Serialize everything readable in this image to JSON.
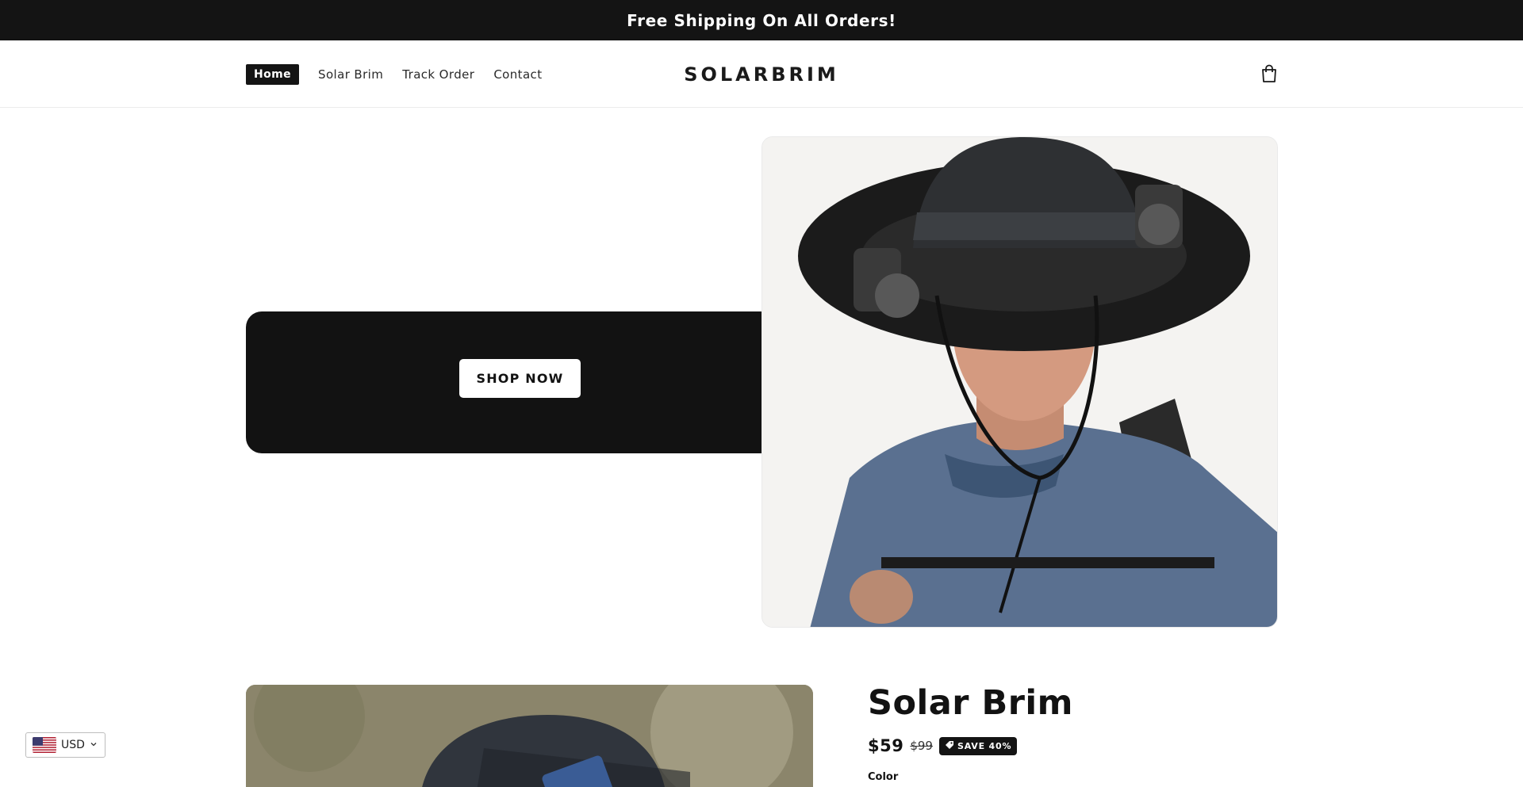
{
  "announcement": {
    "text": "Free Shipping On All Orders!"
  },
  "header": {
    "logo_text": "SOLARBRIM",
    "nav": [
      {
        "label": "Home",
        "active": true
      },
      {
        "label": "Solar Brim",
        "active": false
      },
      {
        "label": "Track Order",
        "active": false
      },
      {
        "label": "Contact",
        "active": false
      }
    ],
    "cart_icon": "shopping-bag-icon"
  },
  "hero": {
    "button_label": "SHOP NOW",
    "image_icon": "man-wearing-solar-fan-hat-photo"
  },
  "product": {
    "title": "Solar Brim",
    "price": "$59",
    "compare_price": "$99",
    "save_badge": "SAVE 40%",
    "badge_icon": "tag-icon",
    "option_label": "Color",
    "image_icon": "solar-hat-product-photo"
  },
  "currency": {
    "code": "USD",
    "flag_icon": "us-flag-icon"
  },
  "colors": {
    "dark": "#141414",
    "text": "#121212",
    "white": "#ffffff"
  }
}
